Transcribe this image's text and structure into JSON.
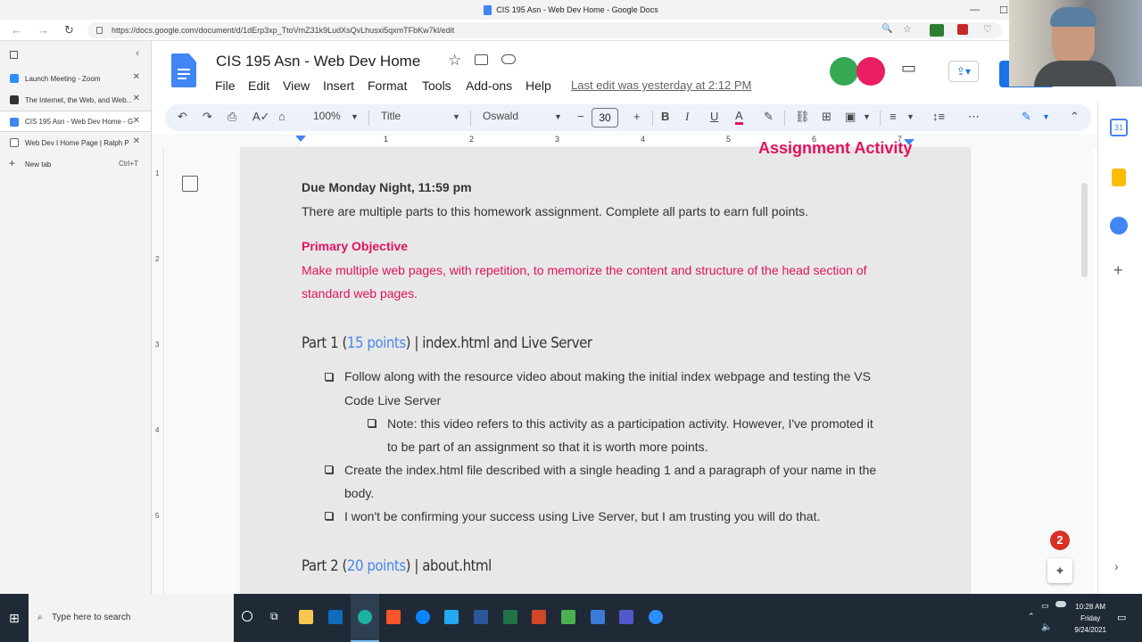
{
  "window": {
    "title": "CIS 195 Asn - Web Dev Home - Google Docs"
  },
  "browser": {
    "url": "https://docs.google.com/document/d/1dErp3xp_TtoVmZ31k9LudXsQvLhusxi5qxmTFbKw7kl/edit"
  },
  "sidebar": {
    "tabs": [
      {
        "label": "Launch Meeting - Zoom",
        "color": "#2d8cff"
      },
      {
        "label": "The Internet, the Web, and Web...",
        "color": "#333333"
      },
      {
        "label": "CIS 195 Asn - Web Dev Home - G",
        "color": "#4285f4",
        "active": true
      },
      {
        "label": "Web Dev I Home Page | Ralph P",
        "color": "#333333"
      }
    ],
    "new_tab": {
      "label": "New tab",
      "shortcut": "Ctrl+T"
    }
  },
  "doc": {
    "title": "CIS 195 Asn - Web Dev Home",
    "menu": [
      "File",
      "Edit",
      "View",
      "Insert",
      "Format",
      "Tools",
      "Add-ons",
      "Help"
    ],
    "last_edit": "Last edit was yesterday at 2:12 PM"
  },
  "toolbar": {
    "zoom": "100%",
    "style": "Title",
    "font": "Oswald",
    "font_size": "30"
  },
  "ruler": {
    "marks": [
      "1",
      "2",
      "3",
      "4",
      "5",
      "6",
      "7"
    ]
  },
  "vruler": {
    "marks": [
      "1",
      "2",
      "3",
      "4",
      "5"
    ]
  },
  "content": {
    "section_title": "Assignment Activity",
    "due": "Due Monday Night, 11:59 pm",
    "intro": "There are multiple parts to this homework assignment. Complete all parts to earn full points.",
    "objective_label": "Primary Objective",
    "objective_line1": "Make multiple web pages, with repetition, to memorize the content and structure of the head section of",
    "objective_line2": "standard web pages.",
    "part1": {
      "pre": "Part 1 (",
      "points": "15 points",
      "post": ") | index.html and Live Server"
    },
    "part1_items": {
      "a1": "Follow along with the resource video about making the initial index webpage and testing the VS",
      "a2": "Code Live Server",
      "b1": "Note: this video refers to this activity as a participation activity. However, I've promoted it",
      "b2": "to be part of an assignment so that it is worth more points.",
      "c1": "Create the index.html file described with a single heading 1 and a paragraph of your name in the",
      "c2": "body.",
      "d1": "I won't be confirming your success using Live Server, but I am trusting you will do that."
    },
    "part2": {
      "pre": "Part 2 (",
      "points": "20 points",
      "post": ") | about.html"
    }
  },
  "notification_badge": "2",
  "taskbar": {
    "search_placeholder": "Type here to search",
    "time": "10:28 AM",
    "day": "Friday",
    "date": "9/24/2021"
  },
  "colors": {
    "accent": "#4285f4",
    "red_text": "#e0135f",
    "points_blue": "#4a86e8"
  }
}
